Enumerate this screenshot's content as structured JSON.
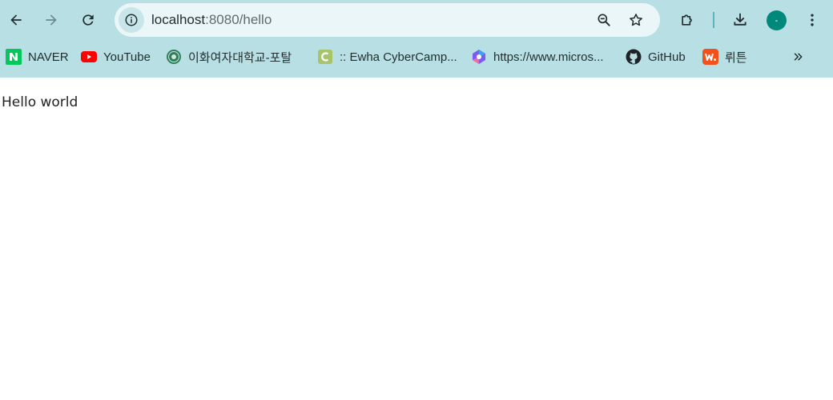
{
  "browser": {
    "address_bar": {
      "host": "localhost",
      "path": ":8080/hello"
    },
    "profile": {
      "avatar_text": "-",
      "color": "#00897b"
    },
    "chrome_color": "#b8e0e4",
    "icons": {
      "back": "back-arrow-icon",
      "forward": "forward-arrow-icon",
      "reload": "reload-icon",
      "site_info": "info-icon",
      "zoom": "zoom-out-icon",
      "bookmark": "star-icon",
      "extensions": "puzzle-icon",
      "downloads": "download-icon",
      "menu": "kebab-menu-icon",
      "more_bookmarks": "double-chevron-icon"
    }
  },
  "bookmarks": [
    {
      "label": "NAVER",
      "icon": "naver-icon"
    },
    {
      "label": "YouTube",
      "icon": "youtube-icon"
    },
    {
      "label": "이화여자대학교-포탈",
      "icon": "ewha-emblem-icon"
    },
    {
      "label": ":: Ewha CyberCamp...",
      "icon": "cybercampus-icon"
    },
    {
      "label": "https://www.micros...",
      "icon": "microsoft-copilot-icon"
    },
    {
      "label": "GitHub",
      "icon": "github-icon"
    },
    {
      "label": "뤼튼",
      "icon": "wrtn-icon"
    }
  ],
  "page": {
    "text": "Hello world"
  }
}
